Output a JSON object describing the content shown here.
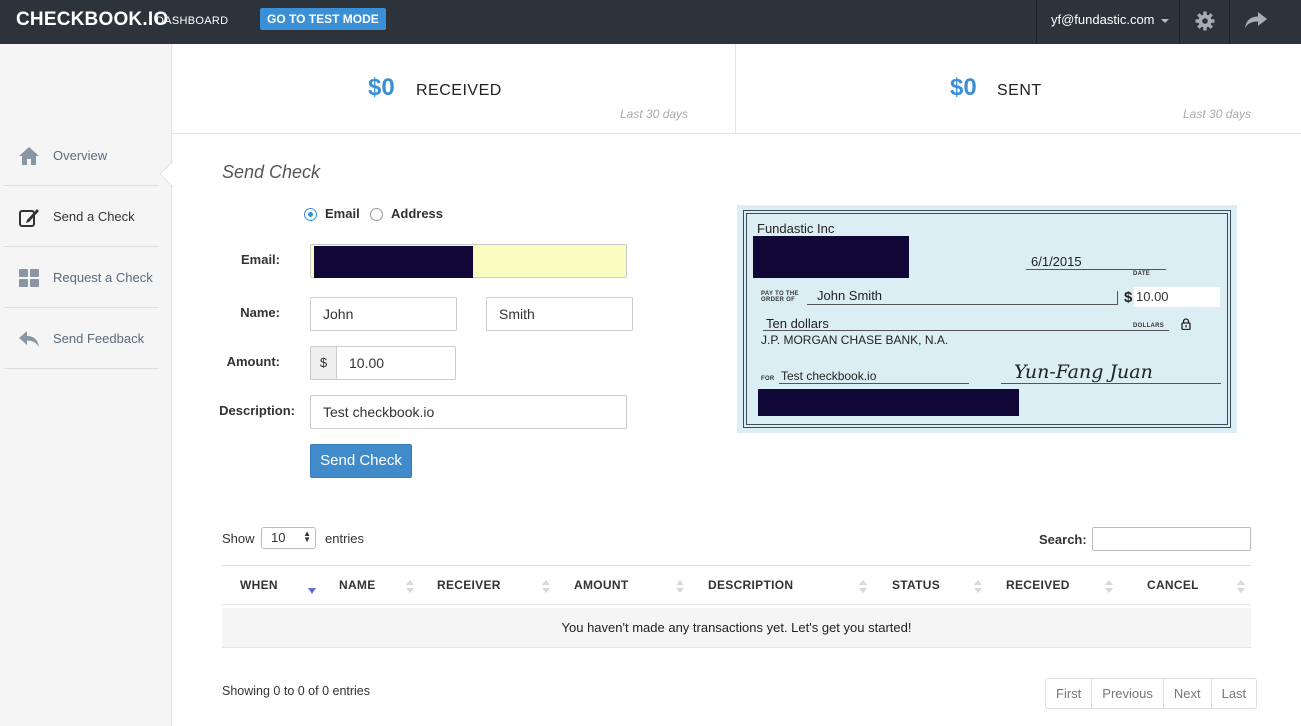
{
  "topbar": {
    "brand": "CHECKBOOK.IO",
    "section": "DASHBOARD",
    "test_mode_button": "GO TO TEST MODE",
    "user_email": "yf@fundastic.com",
    "icons": [
      "gear-icon",
      "share-icon"
    ]
  },
  "sidebar": {
    "items": [
      {
        "label": "Overview",
        "icon": "home-icon"
      },
      {
        "label": "Send a Check",
        "icon": "edit-icon",
        "active": true
      },
      {
        "label": "Request a Check",
        "icon": "grid-icon"
      },
      {
        "label": "Send Feedback",
        "icon": "reply-icon"
      }
    ]
  },
  "stats": {
    "received": {
      "amount": "$0",
      "label": "RECEIVED",
      "period": "Last 30 days"
    },
    "sent": {
      "amount": "$0",
      "label": "SENT",
      "period": "Last 30 days"
    }
  },
  "form": {
    "title": "Send Check",
    "delivery_options": [
      {
        "label": "Email",
        "selected": true
      },
      {
        "label": "Address",
        "selected": false
      }
    ],
    "email_label": "Email:",
    "name_label": "Name:",
    "first_name": "John",
    "last_name": "Smith",
    "amount_label": "Amount:",
    "currency_symbol": "$",
    "amount": "10.00",
    "description_label": "Description:",
    "description": "Test checkbook.io",
    "submit_label": "Send Check"
  },
  "check": {
    "payer": "Fundastic Inc",
    "date": "6/1/2015",
    "date_caption": "DATE",
    "pay_to_caption_1": "PAY TO THE",
    "pay_to_caption_2": "ORDER OF",
    "payee": "John Smith",
    "dollar_sign": "$",
    "amount": "10.00",
    "amount_words": "Ten dollars",
    "dollars_caption": "DOLLARS",
    "bank": "J.P. MORGAN CHASE BANK, N.A.",
    "for_caption": "FOR",
    "memo": "Test checkbook.io",
    "signature": "Yun-Fang Juan"
  },
  "table": {
    "show_label": "Show",
    "entries_value": "10",
    "entries_label": "entries",
    "search_label": "Search:",
    "columns": [
      "WHEN",
      "NAME",
      "RECEIVER",
      "AMOUNT",
      "DESCRIPTION",
      "STATUS",
      "RECEIVED",
      "CANCEL"
    ],
    "empty_message": "You haven't made any transactions yet. Let's get you started!",
    "info": "Showing 0 to 0 of 0 entries",
    "pagination": [
      "First",
      "Previous",
      "Next",
      "Last"
    ]
  }
}
